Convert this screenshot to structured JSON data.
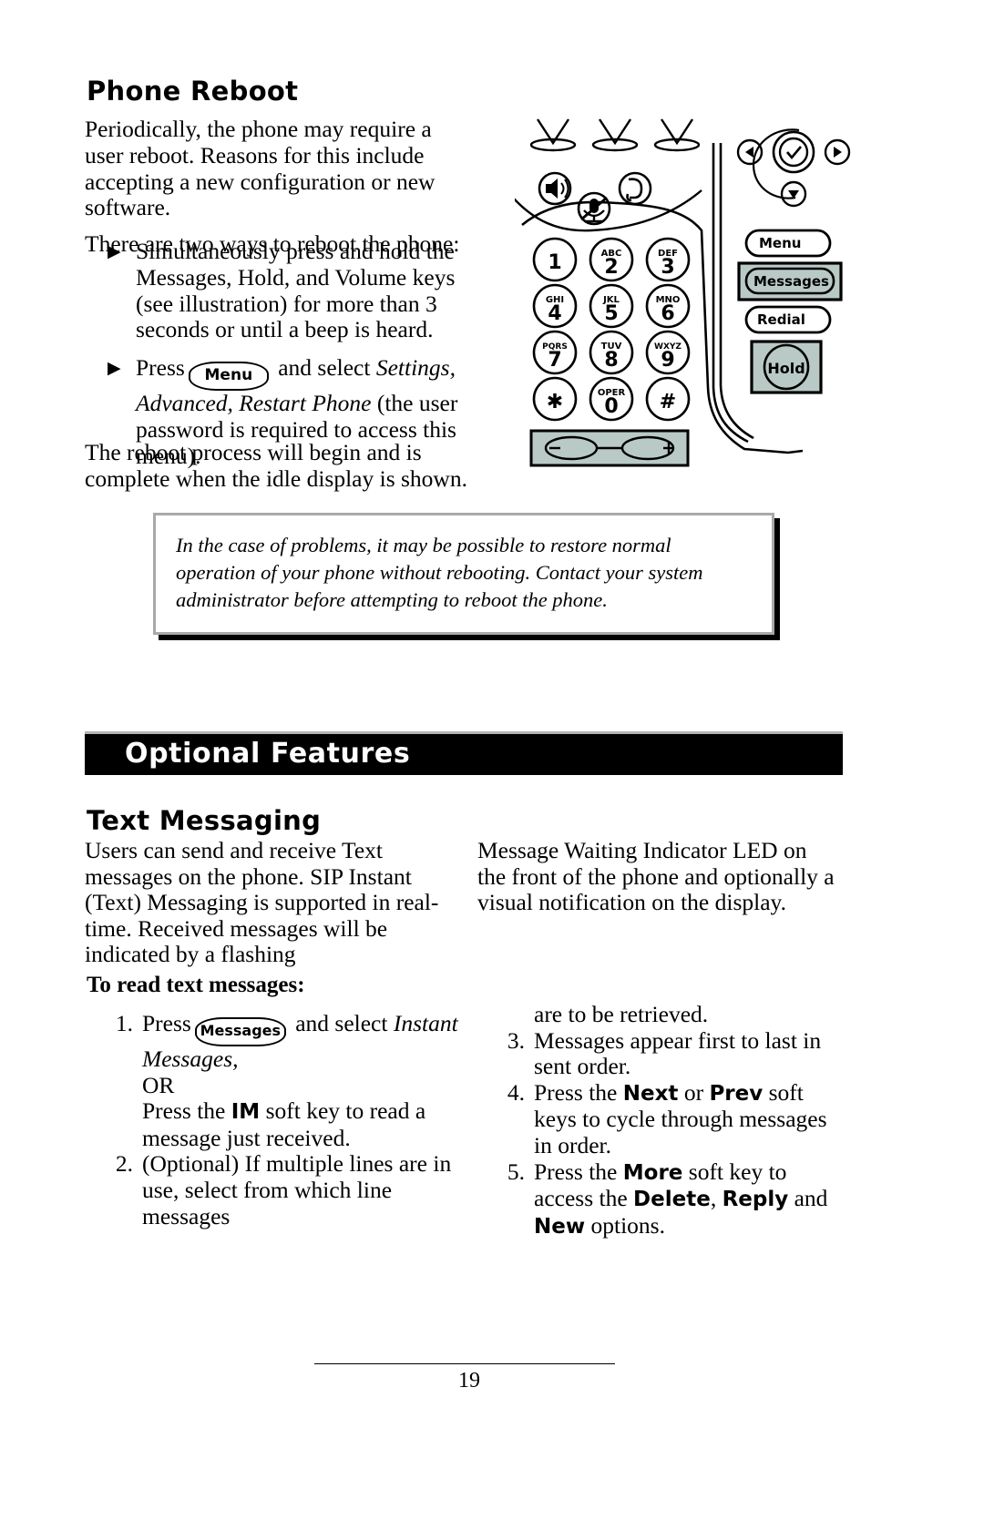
{
  "page": {
    "number": "19"
  },
  "sections": {
    "phone_reboot": {
      "heading": "Phone Reboot",
      "intro_paragraph_1": "Periodically, the phone may require a user reboot.  Reasons for this include accepting a new configuration or new software.",
      "intro_paragraph_2": "There are two ways to reboot the phone:",
      "bullets": [
        {
          "glyph": "▶",
          "text": "Simultaneously press and hold the Messages, Hold, and Volume keys (see illustration) for more than 3 seconds or until a beep is heard."
        },
        {
          "glyph": "▶",
          "text_before_key": "Press",
          "key_label": "Menu",
          "text_after_key": " and select ",
          "italic_text": "Settings, Advanced, Restart Phone",
          "text_tail": " (the user password is required to access this menu)."
        }
      ],
      "closing_paragraph": "The reboot process will begin and is complete when the idle display is shown.",
      "note_box": {
        "text": "In the case of problems, it may be possible to restore normal operation of your phone without rebooting.  Contact your system administrator before attempting to reboot the phone."
      }
    },
    "optional_features": {
      "banner_label": "Optional Features"
    },
    "text_messaging": {
      "heading": "Text Messaging",
      "column_left": "Users can send and receive Text messages on the phone.  SIP Instant (Text) Messaging is supported in real-time.  Received messages will be indicated by a flashing",
      "column_right": "Message Waiting Indicator LED on the front of the phone and optionally a visual notification on the display.",
      "subheading": "To read text messages:",
      "steps_left": [
        {
          "number": "1.",
          "text_before_key": "Press",
          "key_label": "Messages",
          "text_after_key": " and select ",
          "italic_text": "Instant Messages,",
          "or_label": "OR",
          "alt_before": "Press the ",
          "alt_bold": "IM",
          "alt_after": " soft key to read a message just received."
        },
        {
          "number": "2.",
          "text": "(Optional)  If multiple lines are in use, select from which line messages"
        }
      ],
      "steps_right": [
        {
          "continuation": "are to be retrieved."
        },
        {
          "number": "3.",
          "text": "Messages appear first to last in sent order."
        },
        {
          "number": "4.",
          "text_before": "Press the ",
          "bold_1": "Next",
          "text_mid": " or ",
          "bold_2": "Prev",
          "text_after": " soft keys to cycle through messages in order."
        },
        {
          "number": "5.",
          "text_before": "Press the ",
          "bold_1": "More",
          "text_after": " soft key to access the ",
          "bold_2": "Delete",
          "text_mid2": ", ",
          "bold_3": "Reply",
          "text_mid3": " and ",
          "bold_4": "New",
          "text_tail": " options."
        }
      ]
    }
  },
  "phone_illustration": {
    "alt": "IP phone front panel illustration",
    "keypad": [
      {
        "digit": "1",
        "letters": ""
      },
      {
        "digit": "2",
        "letters": "ABC"
      },
      {
        "digit": "3",
        "letters": "DEF"
      },
      {
        "digit": "4",
        "letters": "GHI"
      },
      {
        "digit": "5",
        "letters": "JKL"
      },
      {
        "digit": "6",
        "letters": "MNO"
      },
      {
        "digit": "7",
        "letters": "PQRS"
      },
      {
        "digit": "8",
        "letters": "TUV"
      },
      {
        "digit": "9",
        "letters": "WXYZ"
      },
      {
        "digit": "✱",
        "letters": ""
      },
      {
        "digit": "0",
        "letters": "OPER"
      },
      {
        "digit": "#",
        "letters": ""
      }
    ],
    "soft_keys": [
      {
        "label": "Menu",
        "highlighted": false
      },
      {
        "label": "Messages",
        "highlighted": true
      },
      {
        "label": "Redial",
        "highlighted": false
      },
      {
        "label": "Hold",
        "highlighted": true
      }
    ],
    "feature_icons": [
      "speaker-icon",
      "mute-icon",
      "headset-icon"
    ],
    "nav_icons": [
      "nav-left-icon",
      "nav-select-icon",
      "nav-right-icon",
      "nav-down-icon"
    ],
    "volume_key": "volume-rocker",
    "highlight_color": "#b9c9c6"
  }
}
